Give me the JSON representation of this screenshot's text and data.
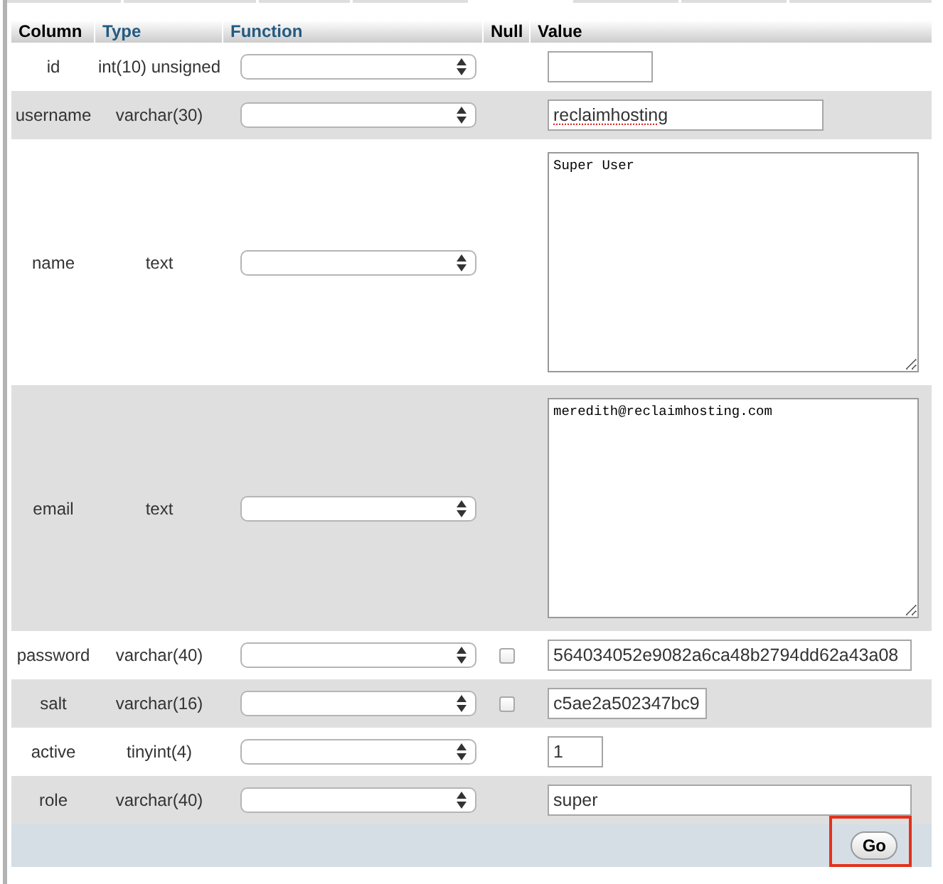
{
  "table": {
    "columns": [
      {
        "label": "Column",
        "kind": "label"
      },
      {
        "label": "Type",
        "kind": "link"
      },
      {
        "label": "Function",
        "kind": "link"
      },
      {
        "label": "Null",
        "kind": "label"
      },
      {
        "label": "Value",
        "kind": "label"
      }
    ],
    "rows": [
      {
        "column": "id",
        "type": "int(10) unsigned",
        "kind": "input"
      },
      {
        "column": "username",
        "type": "varchar(30)",
        "kind": "input",
        "value": "reclaimhosting",
        "misspelled": true
      },
      {
        "column": "name",
        "type": "text",
        "kind": "textarea",
        "value": "Super User",
        "misspelled": false
      },
      {
        "column": "email",
        "type": "text",
        "kind": "textarea",
        "value": "meredith@reclaimhosting.com",
        "misspelled": false
      },
      {
        "column": "password",
        "type": "varchar(40)",
        "kind": "input",
        "value": "564034052e9082a6ca48b2794dd62a43a08",
        "misspelled": false,
        "null_checkbox": {
          "checked": false
        }
      },
      {
        "column": "salt",
        "type": "varchar(16)",
        "kind": "input",
        "value": "c5ae2a502347bc9",
        "misspelled": false,
        "null_checkbox": {
          "checked": false
        }
      },
      {
        "column": "active",
        "type": "tinyint(4)",
        "kind": "input",
        "value": "1",
        "misspelled": false
      },
      {
        "column": "role",
        "type": "varchar(40)",
        "kind": "input",
        "value": "super",
        "misspelled": false
      }
    ]
  },
  "go_button": {
    "label": "Go",
    "highlighted": true
  }
}
